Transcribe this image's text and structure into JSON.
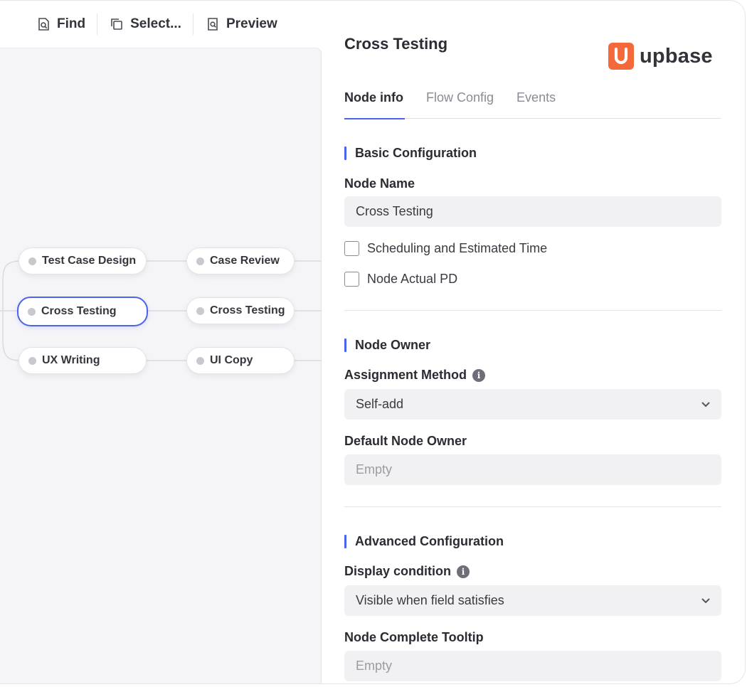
{
  "toolbar": {
    "find": "Find",
    "select": "Select...",
    "preview": "Preview"
  },
  "canvas": {
    "nodes": [
      {
        "label": "Test Case Design"
      },
      {
        "label": "Case Review"
      },
      {
        "label": "Cross Testing",
        "selected": true
      },
      {
        "label": "Cross Testing"
      },
      {
        "label": "UX Writing"
      },
      {
        "label": "UI Copy"
      }
    ]
  },
  "panel": {
    "title": "Cross Testing",
    "brand": "upbase",
    "tabs": [
      {
        "label": "Node info",
        "active": true
      },
      {
        "label": "Flow Config"
      },
      {
        "label": "Events"
      }
    ],
    "basic": {
      "heading": "Basic Configuration",
      "node_name_label": "Node Name",
      "node_name_value": "Cross Testing",
      "checkbox_scheduling": "Scheduling and Estimated Time",
      "checkbox_actual_pd": "Node Actual PD"
    },
    "owner": {
      "heading": "Node Owner",
      "assignment_label": "Assignment Method",
      "assignment_value": "Self-add",
      "default_owner_label": "Default Node Owner",
      "default_owner_placeholder": "Empty"
    },
    "advanced": {
      "heading": "Advanced Configuration",
      "display_condition_label": "Display condition",
      "display_condition_value": "Visible when field satisfies",
      "tooltip_label": "Node Complete Tooltip",
      "tooltip_placeholder": "Empty"
    }
  },
  "colors": {
    "accent": "#4b63ea",
    "brand": "#f4693a",
    "canvas_bg": "#f5f5f8",
    "field_bg": "#f1f1f4"
  },
  "icons": {
    "find": "find-icon",
    "select": "select-icon",
    "preview": "preview-icon",
    "info": "info-icon",
    "chevron": "chevron-down-icon",
    "brand": "upbase-logo-icon"
  }
}
